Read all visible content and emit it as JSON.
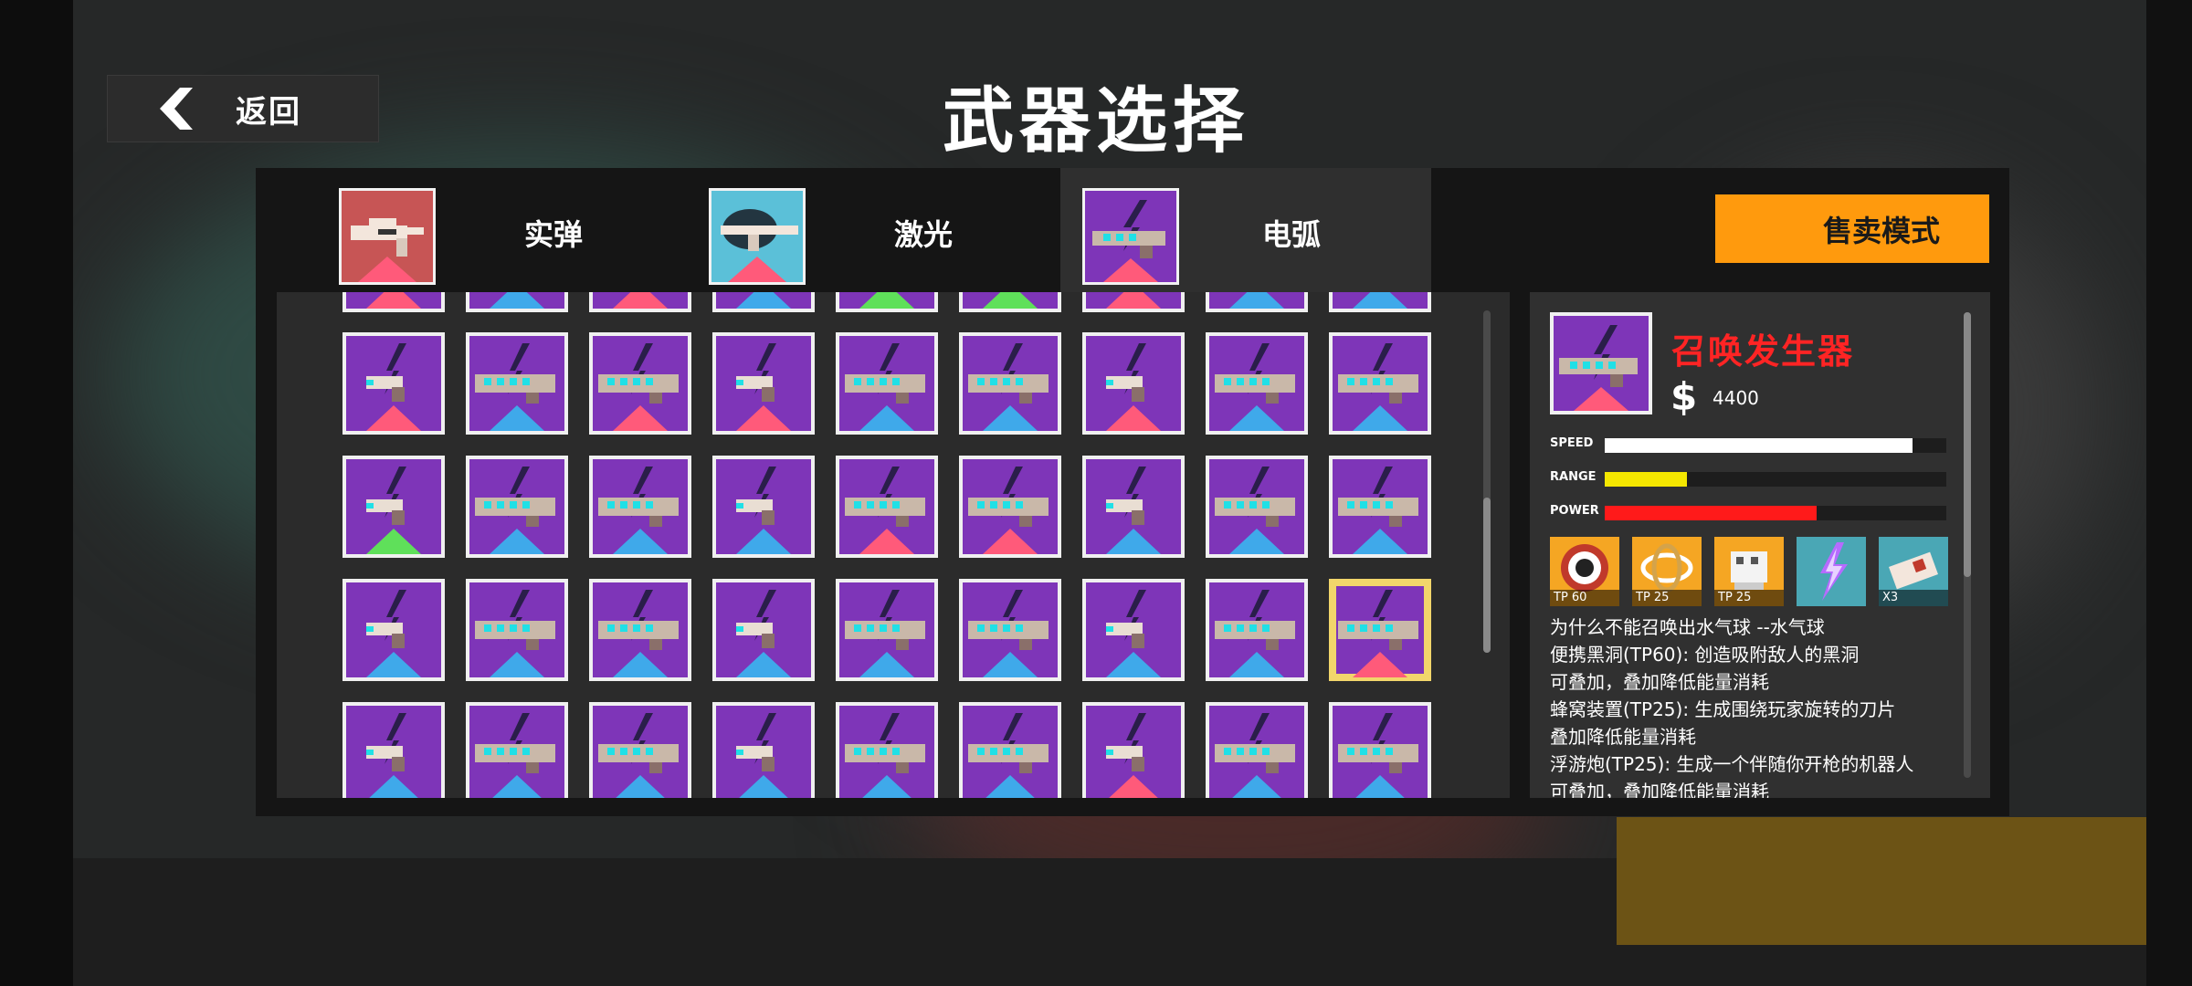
{
  "header": {
    "back_label": "返回",
    "title": "武器选择"
  },
  "tabs": [
    {
      "label": "实弹",
      "active": false,
      "color": "#c75555",
      "stripe": "#ff5a7a"
    },
    {
      "label": "激光",
      "active": false,
      "color": "#5bc0d8",
      "stripe": "#ff5a7a"
    },
    {
      "label": "电弧",
      "active": true,
      "color": "#7e35b8",
      "stripe": "#ff5a7a"
    }
  ],
  "sell_mode_label": "售卖模式",
  "grid": {
    "rows": [
      [
        "pink",
        "blue",
        "pink",
        "blue",
        "green",
        "green",
        "pink",
        "blue",
        "blue"
      ],
      [
        "pink",
        "blue",
        "pink",
        "pink",
        "blue",
        "blue",
        "pink",
        "blue",
        "blue"
      ],
      [
        "green",
        "blue",
        "blue",
        "blue",
        "pink",
        "pink",
        "blue",
        "blue",
        "blue"
      ],
      [
        "blue",
        "blue",
        "blue",
        "blue",
        "blue",
        "blue",
        "blue",
        "blue",
        "pink"
      ],
      [
        "blue",
        "blue",
        "blue",
        "blue",
        "blue",
        "blue",
        "pink",
        "blue",
        "blue"
      ]
    ],
    "selected": [
      3,
      8
    ]
  },
  "detail": {
    "name": "召唤发生器",
    "currency_icon": "$",
    "price": "4400",
    "stats": [
      {
        "label": "SPEED",
        "value": 0.9,
        "color": "#ffffff"
      },
      {
        "label": "RANGE",
        "value": 0.24,
        "color": "#f4e700"
      },
      {
        "label": "POWER",
        "value": 0.62,
        "color": "#ff1a1a"
      }
    ],
    "mods": [
      {
        "name": "black-hole-module-icon",
        "tp": "TP 60",
        "bg": "#f5a623"
      },
      {
        "name": "hive-device-module-icon",
        "tp": "TP 25",
        "bg": "#f5a623"
      },
      {
        "name": "floating-cannon-module-icon",
        "tp": "TP 25",
        "bg": "#f5a623"
      },
      {
        "name": "lightning-module-icon",
        "tp": "",
        "bg": "#4aa7b5"
      },
      {
        "name": "bullet-module-icon",
        "tp": "X3",
        "bg": "#4aa7b5"
      }
    ],
    "description": [
      "为什么不能召唤出水气球 --水气球",
      "便携黑洞(TP60): 创造吸附敌人的黑洞",
      "可叠加，叠加降低能量消耗",
      "蜂窝装置(TP25): 生成围绕玩家旋转的刀片",
      "叠加降低能量消耗",
      "浮游炮(TP25): 生成一个伴随你开枪的机器人",
      "可叠加，叠加降低能量消耗"
    ]
  }
}
